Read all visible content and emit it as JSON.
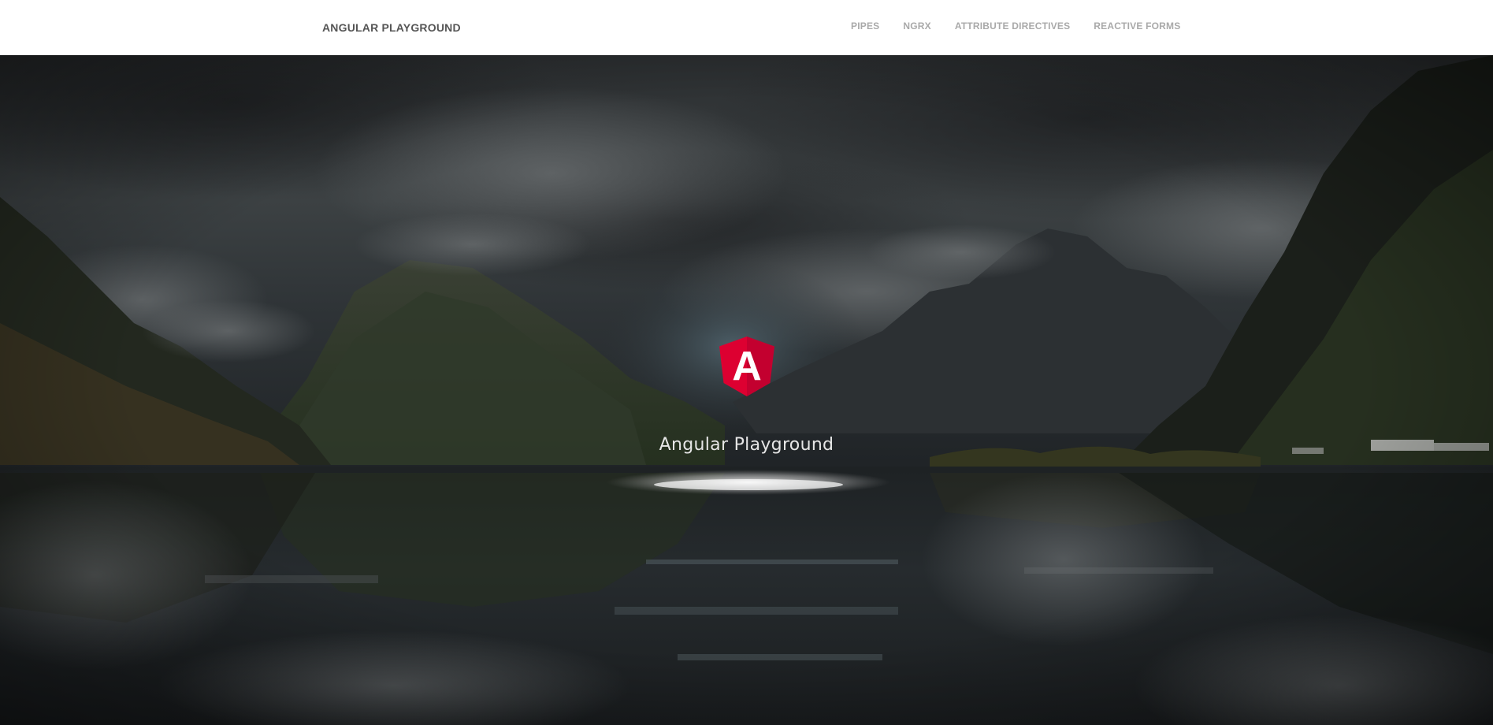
{
  "navbar": {
    "brand": "ANGULAR PLAYGROUND",
    "links": [
      {
        "label": "PIPES"
      },
      {
        "label": "NGRX"
      },
      {
        "label": "ATTRIBUTE DIRECTIVES"
      },
      {
        "label": "REACTIVE FORMS"
      }
    ]
  },
  "hero": {
    "logo_icon": "angular-logo-icon",
    "logo_letter": "A",
    "title": "Angular Playground"
  },
  "colors": {
    "navbar_bg": "#ffffff",
    "brand_text": "#555555",
    "nav_link_text": "#a9a9a9",
    "angular_red": "#dd0031",
    "angular_red_dark": "#c3002f",
    "hero_title": "#e6e6e6"
  }
}
